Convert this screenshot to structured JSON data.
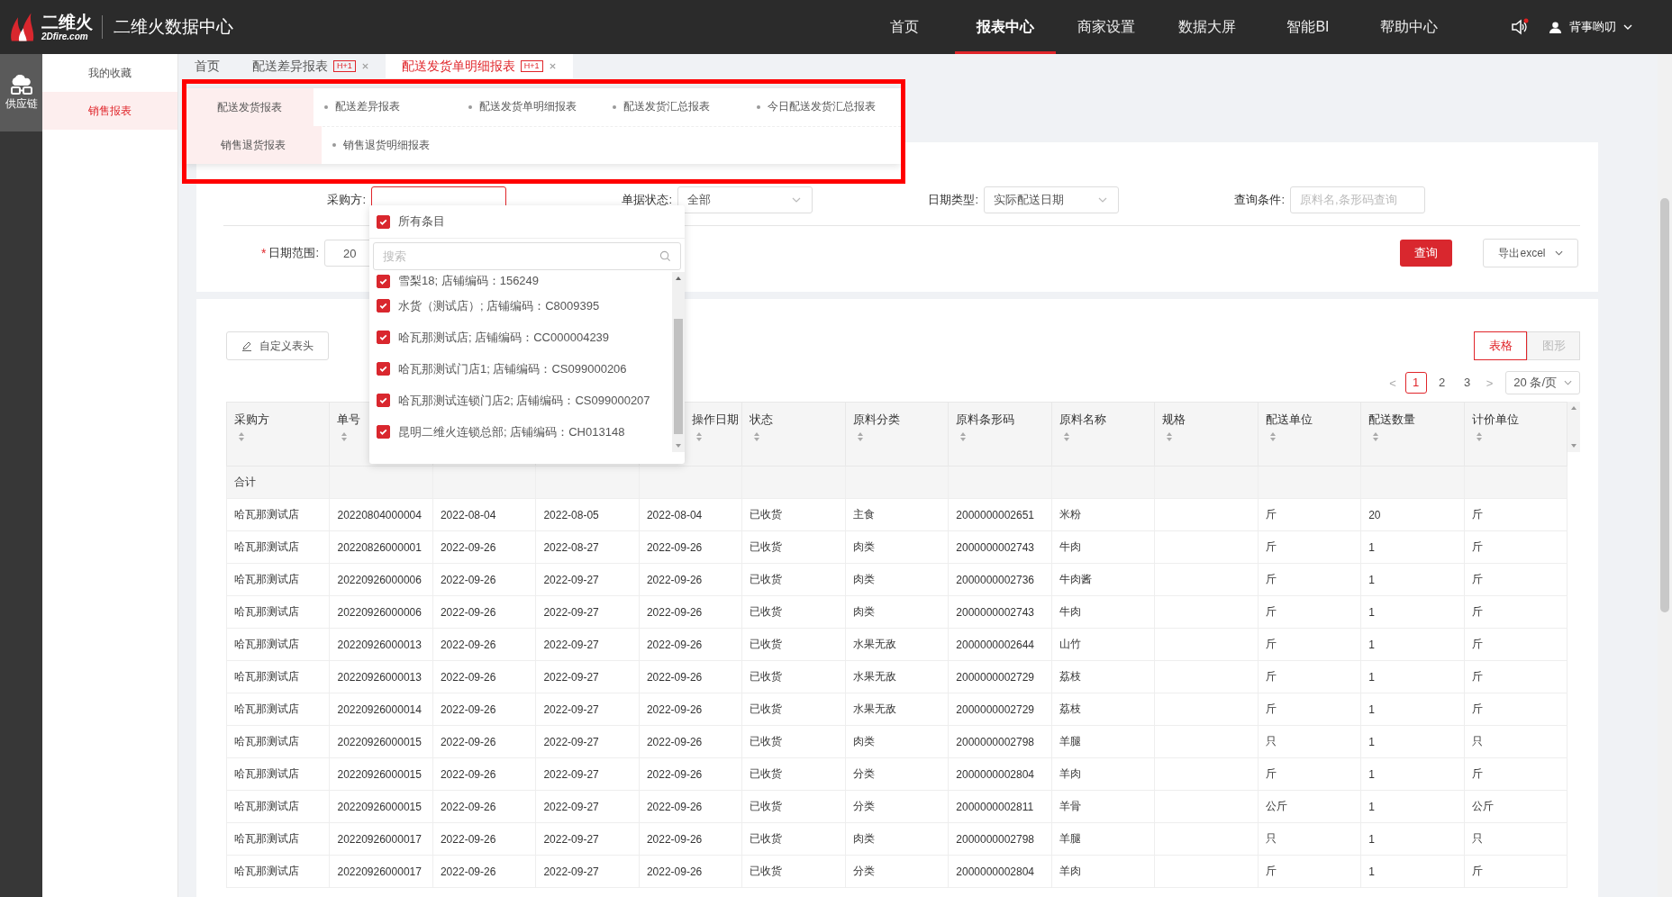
{
  "header": {
    "logo_name": "二维火",
    "logo_domain": "2Dfire.com",
    "title": "二维火数据中心",
    "nav": [
      {
        "label": "首页",
        "selected": false
      },
      {
        "label": "报表中心",
        "selected": true
      },
      {
        "label": "商家设置",
        "selected": false
      },
      {
        "label": "数据大屏",
        "selected": false
      },
      {
        "label": "智能BI",
        "selected": false
      },
      {
        "label": "帮助中心",
        "selected": false
      }
    ],
    "sound_alert": true,
    "user": "背事哟叨"
  },
  "rail": {
    "items": [
      {
        "label": "供应链",
        "selected": true
      }
    ]
  },
  "sidebar": {
    "items": [
      {
        "label": "我的收藏",
        "selected": false
      },
      {
        "label": "销售报表",
        "selected": true
      }
    ]
  },
  "tabs": [
    {
      "label": "首页",
      "closable": false,
      "selected": false
    },
    {
      "label": "配送差异报表",
      "badge": "H+1",
      "closable": true,
      "selected": false
    },
    {
      "label": "配送发货单明细报表",
      "badge": "H+1",
      "closable": true,
      "selected": true
    }
  ],
  "menu": {
    "highlighted": true,
    "groups": [
      {
        "title": "配送发货报表",
        "items": [
          "配送差异报表",
          "配送发货单明细报表",
          "配送发货汇总报表",
          "今日配送发货汇总报表"
        ]
      },
      {
        "title": "销售退货报表",
        "items": [
          "销售退货明细报表"
        ]
      }
    ]
  },
  "filters": {
    "row1": [
      {
        "label": "采购方:",
        "kind": "multi"
      },
      {
        "label": "单据状态:",
        "kind": "select",
        "value": "全部"
      },
      {
        "label": "日期类型:",
        "kind": "select",
        "value": "实际配送日期"
      },
      {
        "label": "查询条件:",
        "kind": "text",
        "placeholder": "原料名,条形码查询"
      }
    ],
    "date_range": {
      "required_mark": "*",
      "label": "日期范围:",
      "value": "20"
    },
    "query_button": "查询",
    "export_button": "导出excel"
  },
  "dropdown": {
    "all_label": "所有条目",
    "all_checked": true,
    "search_placeholder": "搜索",
    "options": [
      {
        "label": "雪梨18; 店铺编码：156249",
        "checked": true
      },
      {
        "label": "水货（测试店）; 店铺编码：C8009395",
        "checked": true
      },
      {
        "label": "哈瓦那测试店; 店铺编码：CC000004239",
        "checked": true
      },
      {
        "label": "哈瓦那测试门店1; 店铺编码：CS099000206",
        "checked": true
      },
      {
        "label": "哈瓦那测试连锁门店2; 店铺编码：CS099000207",
        "checked": true
      },
      {
        "label": "昆明二维火连锁总部; 店铺编码：CH013148",
        "checked": true
      }
    ]
  },
  "toolbar": {
    "customize_button": "自定义表头",
    "views": [
      {
        "label": "表格",
        "selected": true
      },
      {
        "label": "图形",
        "selected": false
      }
    ]
  },
  "pagination": {
    "prev": "<",
    "pages": [
      {
        "label": "1",
        "selected": true
      },
      {
        "label": "2",
        "selected": false
      },
      {
        "label": "3",
        "selected": false
      }
    ],
    "next": ">",
    "page_size": "20 条/页"
  },
  "table": {
    "columns": [
      {
        "kind": "labeled",
        "label": "采购方"
      },
      {
        "kind": "labeled",
        "label": "单号"
      },
      {
        "kind": "covered"
      },
      {
        "kind": "covered"
      },
      {
        "kind": "labeled",
        "label": "操作日期"
      },
      {
        "kind": "labeled",
        "label": "状态"
      },
      {
        "kind": "labeled",
        "label": "原料分类"
      },
      {
        "kind": "labeled",
        "label": "原料条形码"
      },
      {
        "kind": "labeled",
        "label": "原料名称"
      },
      {
        "kind": "labeled",
        "label": "规格"
      },
      {
        "kind": "labeled",
        "label": "配送单位"
      },
      {
        "kind": "labeled",
        "label": "配送数量"
      },
      {
        "kind": "labeled",
        "label": "计价单位"
      }
    ],
    "total_label": "合计",
    "rows": [
      [
        "哈瓦那测试店",
        "20220804000004",
        "2022-08-04",
        "2022-08-05",
        "2022-08-04",
        "已收货",
        "主食",
        "2000000002651",
        "米粉",
        null,
        "斤",
        "20",
        "斤"
      ],
      [
        "哈瓦那测试店",
        "20220826000001",
        "2022-09-26",
        "2022-08-27",
        "2022-09-26",
        "已收货",
        "肉类",
        "2000000002743",
        "牛肉",
        null,
        "斤",
        "1",
        "斤"
      ],
      [
        "哈瓦那测试店",
        "20220926000006",
        "2022-09-26",
        "2022-09-27",
        "2022-09-26",
        "已收货",
        "肉类",
        "2000000002736",
        "牛肉酱",
        null,
        "斤",
        "1",
        "斤"
      ],
      [
        "哈瓦那测试店",
        "20220926000006",
        "2022-09-26",
        "2022-09-27",
        "2022-09-26",
        "已收货",
        "肉类",
        "2000000002743",
        "牛肉",
        null,
        "斤",
        "1",
        "斤"
      ],
      [
        "哈瓦那测试店",
        "20220926000013",
        "2022-09-26",
        "2022-09-27",
        "2022-09-26",
        "已收货",
        "水果无敌",
        "2000000002644",
        "山竹",
        null,
        "斤",
        "1",
        "斤"
      ],
      [
        "哈瓦那测试店",
        "20220926000013",
        "2022-09-26",
        "2022-09-27",
        "2022-09-26",
        "已收货",
        "水果无敌",
        "2000000002729",
        "荔枝",
        null,
        "斤",
        "1",
        "斤"
      ],
      [
        "哈瓦那测试店",
        "20220926000014",
        "2022-09-26",
        "2022-09-27",
        "2022-09-26",
        "已收货",
        "水果无敌",
        "2000000002729",
        "荔枝",
        null,
        "斤",
        "1",
        "斤"
      ],
      [
        "哈瓦那测试店",
        "20220926000015",
        "2022-09-26",
        "2022-09-27",
        "2022-09-26",
        "已收货",
        "肉类",
        "2000000002798",
        "羊腿",
        null,
        "只",
        "1",
        "只"
      ],
      [
        "哈瓦那测试店",
        "20220926000015",
        "2022-09-26",
        "2022-09-27",
        "2022-09-26",
        "已收货",
        "分类",
        "2000000002804",
        "羊肉",
        null,
        "斤",
        "1",
        "斤"
      ],
      [
        "哈瓦那测试店",
        "20220926000015",
        "2022-09-26",
        "2022-09-27",
        "2022-09-26",
        "已收货",
        "分类",
        "2000000002811",
        "羊骨",
        null,
        "公斤",
        "1",
        "公斤"
      ],
      [
        "哈瓦那测试店",
        "20220926000017",
        "2022-09-26",
        "2022-09-27",
        "2022-09-26",
        "已收货",
        "肉类",
        "2000000002798",
        "羊腿",
        null,
        "只",
        "1",
        "只"
      ],
      [
        "哈瓦那测试店",
        "20220926000017",
        "2022-09-26",
        "2022-09-27",
        "2022-09-26",
        "已收货",
        "分类",
        "2000000002804",
        "羊肉",
        null,
        "斤",
        "1",
        "斤"
      ]
    ]
  }
}
